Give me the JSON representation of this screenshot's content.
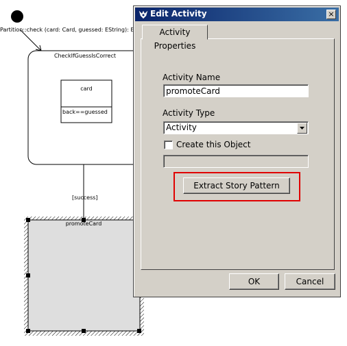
{
  "diagram": {
    "partition_label": "Partition::check (card: Card, guessed: EString): EBoolean",
    "state_name": "CheckIfGuessIsCorrect",
    "object_name": "card",
    "object_attribute": "back==guessed",
    "transition_guard": "[success]",
    "activity_name": "promoteCard"
  },
  "dialog": {
    "title": "Edit Activity",
    "close_glyph": "×",
    "tab_label": "Activity Properties",
    "activity_name_label": "Activity Name",
    "activity_name_value": "promoteCard",
    "activity_type_label": "Activity Type",
    "activity_type_value": "Activity",
    "create_object_label": "Create this Object",
    "create_object_checked": false,
    "extract_button": "Extract Story Pattern",
    "ok_button": "OK",
    "cancel_button": "Cancel"
  },
  "colors": {
    "titlebar": "#0a246a",
    "dialog_bg": "#d4d0c8",
    "highlight": "#e00000",
    "selection_fill": "#dedede"
  }
}
